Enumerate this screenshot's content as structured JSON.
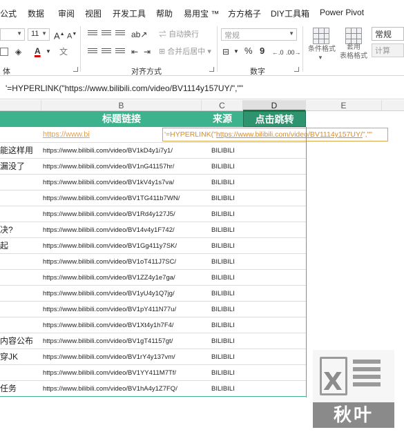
{
  "ribbon": {
    "tabs": [
      "公式",
      "数据",
      "审阅",
      "视图",
      "开发工具",
      "帮助",
      "易用宝 ™",
      "方方格子",
      "DIY工具箱",
      "Power Pivot"
    ],
    "font_size": "11",
    "grow_font": "A",
    "shrink_font": "A",
    "font_color": "A",
    "wrap_text": "自动换行",
    "merge_center": "合并后居中",
    "number_format": "常规",
    "percent": "%",
    "comma": "9",
    "conditional_format": "条件格式",
    "format_as_table": "套用\n表格格式",
    "cell_style": "常规",
    "calc_label": "计算",
    "group_font_partial": "体",
    "group_alignment": "对齐方式",
    "group_number": "数字"
  },
  "formula_bar": {
    "content": "'=HYPERLINK(\"https://www.bilibili.com/video/BV1114y157UY/\",\"\""
  },
  "columns": {
    "b": "B",
    "c": "C",
    "d": "D",
    "e": "E"
  },
  "table": {
    "header_b": "标题链接",
    "header_c": "来源",
    "header_d": "点击跳转",
    "editing_link_partial": "https://www.bi",
    "editing_formula_prefix": "'=HYPERLINK(\"",
    "editing_formula_url": "https://www.bilibili.com/video/BV1114y157UY/",
    "editing_formula_suffix": "\",\"\"",
    "rows": [
      {
        "a": "能这样用",
        "b": "https://www.bilibili.com/video/BV1kD4y1i7y1/",
        "c": "BILIBILI"
      },
      {
        "a": "漏没了",
        "b": "https://www.bilibili.com/video/BV1nG41157hr/",
        "c": "BILIBILI"
      },
      {
        "a": "",
        "b": "https://www.bilibili.com/video/BV1kV4y1s7va/",
        "c": "BILIBILI"
      },
      {
        "a": "",
        "b": "https://www.bilibili.com/video/BV1TG411b7WN/",
        "c": "BILIBILI"
      },
      {
        "a": "",
        "b": "https://www.bilibili.com/video/BV1Rd4y127J5/",
        "c": "BILIBILI"
      },
      {
        "a": "决?",
        "b": "https://www.bilibili.com/video/BV14v4y1F742/",
        "c": "BILIBILI"
      },
      {
        "a": "起",
        "b": "https://www.bilibili.com/video/BV1Gg411y7SK/",
        "c": "BILIBILI"
      },
      {
        "a": "",
        "b": "https://www.bilibili.com/video/BV1oT411J7SC/",
        "c": "BILIBILI"
      },
      {
        "a": "",
        "b": "https://www.bilibili.com/video/BV1ZZ4y1e7ga/",
        "c": "BILIBILI"
      },
      {
        "a": "",
        "b": "https://www.bilibili.com/video/BV1yU4y1Q7jg/",
        "c": "BILIBILI"
      },
      {
        "a": "",
        "b": "https://www.bilibili.com/video/BV1pY411N77u/",
        "c": "BILIBILI"
      },
      {
        "a": "",
        "b": "https://www.bilibili.com/video/BV1Xt4y1h7F4/",
        "c": "BILIBILI"
      },
      {
        "a": "内容公布",
        "b": "https://www.bilibili.com/video/BV1gT41157gt/",
        "c": "BILIBILI"
      },
      {
        "a": "穿JK",
        "b": "https://www.bilibili.com/video/BV1rY4y137vm/",
        "c": "BILIBILI"
      },
      {
        "a": "",
        "b": "https://www.bilibili.com/video/BV1YY411M7Tf/",
        "c": "BILIBILI"
      },
      {
        "a": "任务",
        "b": "https://www.bilibili.com/video/BV1hA4y1Z7FQ/",
        "c": "BILIBILI"
      }
    ]
  },
  "watermark": {
    "letter": "X",
    "brand": "秋叶"
  },
  "colors": {
    "header_green": "#3cb38d",
    "link_orange": "#e0a050"
  }
}
